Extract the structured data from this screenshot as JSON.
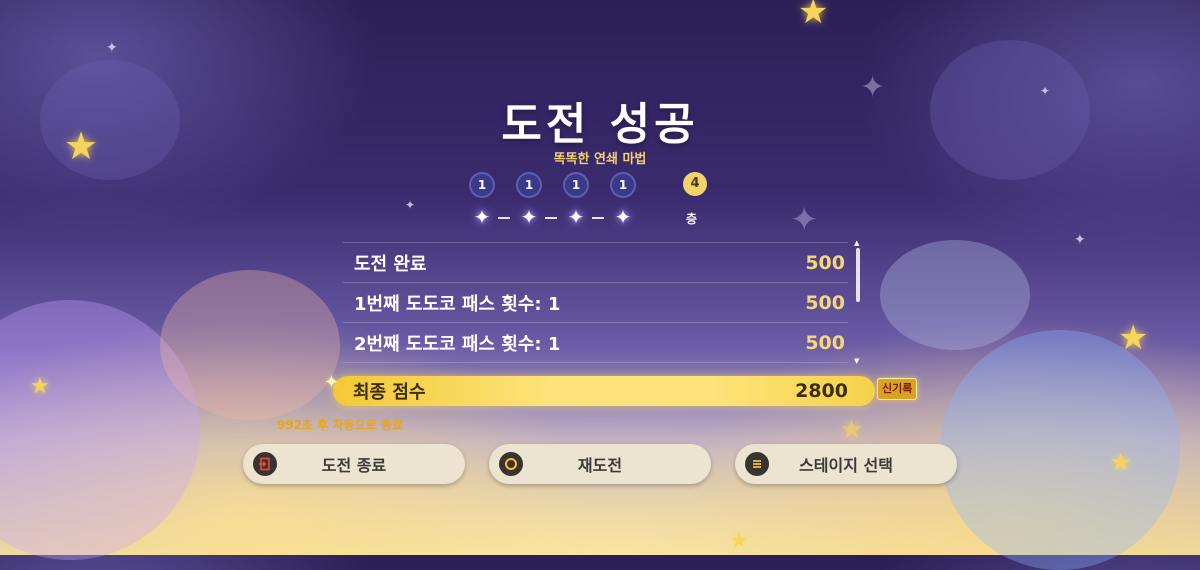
{
  "result": {
    "title": "도전 성공",
    "subtitle": "똑똑한 연쇄 마법"
  },
  "chain": {
    "counts": [
      "1",
      "1",
      "1",
      "1"
    ],
    "floor_number": "4",
    "floor_label": "층"
  },
  "score_rows": [
    {
      "label": "도전 완료",
      "value": "500"
    },
    {
      "label": "1번째 도도코 패스 횟수: 1",
      "value": "500"
    },
    {
      "label": "2번째 도도코 패스 횟수: 1",
      "value": "500"
    }
  ],
  "final_score": {
    "label": "최종 점수",
    "value": "2800",
    "badge": "신기록"
  },
  "auto_close": "992초 후 자동으로 종료",
  "buttons": {
    "quit": {
      "label": "도전 종료",
      "icon": "exit-icon"
    },
    "retry": {
      "label": "재도전",
      "icon": "circle-icon"
    },
    "stage_select": {
      "label": "스테이지 선택",
      "icon": "menu-icon"
    }
  },
  "colors": {
    "accent_gold": "#f5d77a",
    "final_bar": "#fde37a",
    "button_bg": "#ece3d1",
    "quit_icon_red": "#e0473a",
    "retry_icon_gold": "#f1c232"
  }
}
